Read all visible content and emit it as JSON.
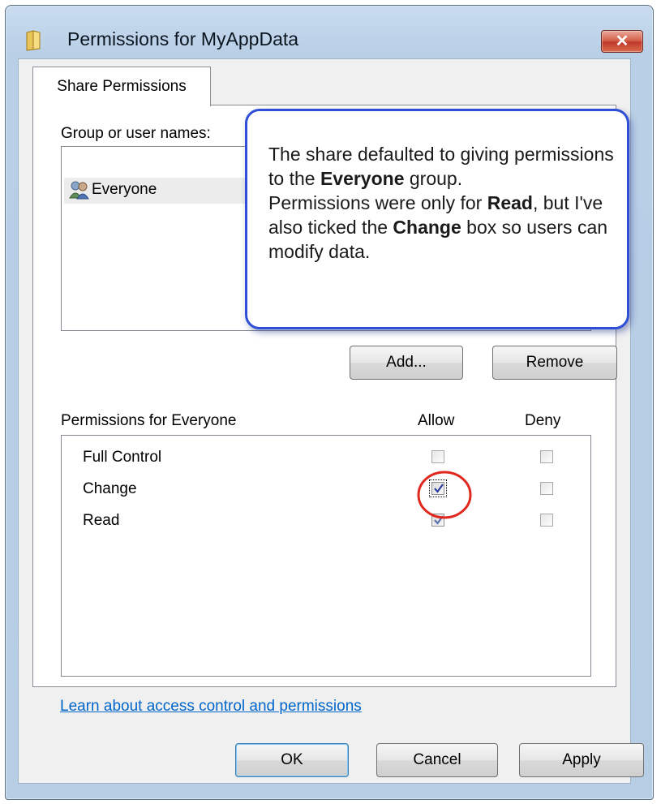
{
  "window": {
    "title": "Permissions for MyAppData",
    "close_glyph": "✕"
  },
  "tabs": [
    {
      "label": "Share Permissions",
      "selected": true
    }
  ],
  "group_section": {
    "label": "Group or user names:",
    "items": [
      {
        "name": "Everyone",
        "icon": "users-icon",
        "selected": true
      }
    ],
    "add_button": "Add...",
    "remove_button": "Remove"
  },
  "permissions_section": {
    "label": "Permissions for Everyone",
    "allow_header": "Allow",
    "deny_header": "Deny",
    "rows": [
      {
        "name": "Full Control",
        "allow": false,
        "deny": false
      },
      {
        "name": "Change",
        "allow": true,
        "deny": false
      },
      {
        "name": "Read",
        "allow": true,
        "deny": false
      }
    ]
  },
  "help_link": "Learn about access control and permissions",
  "footer": {
    "ok": "OK",
    "cancel": "Cancel",
    "apply": "Apply"
  },
  "callout": {
    "line1_pre": "The share defaulted to giving permissions to the ",
    "line1_bold": "Everyone",
    "line1_post": " group.",
    "line2_pre": "Permissions were only for ",
    "line2_bold1": "Read",
    "line2_mid": ", but I've also ticked the ",
    "line2_bold2": "Change",
    "line2_post": " box so users can modify data."
  },
  "colors": {
    "callout_border": "#2f4fd6",
    "annotation_circle": "#e0281e",
    "link": "#0066cc"
  }
}
